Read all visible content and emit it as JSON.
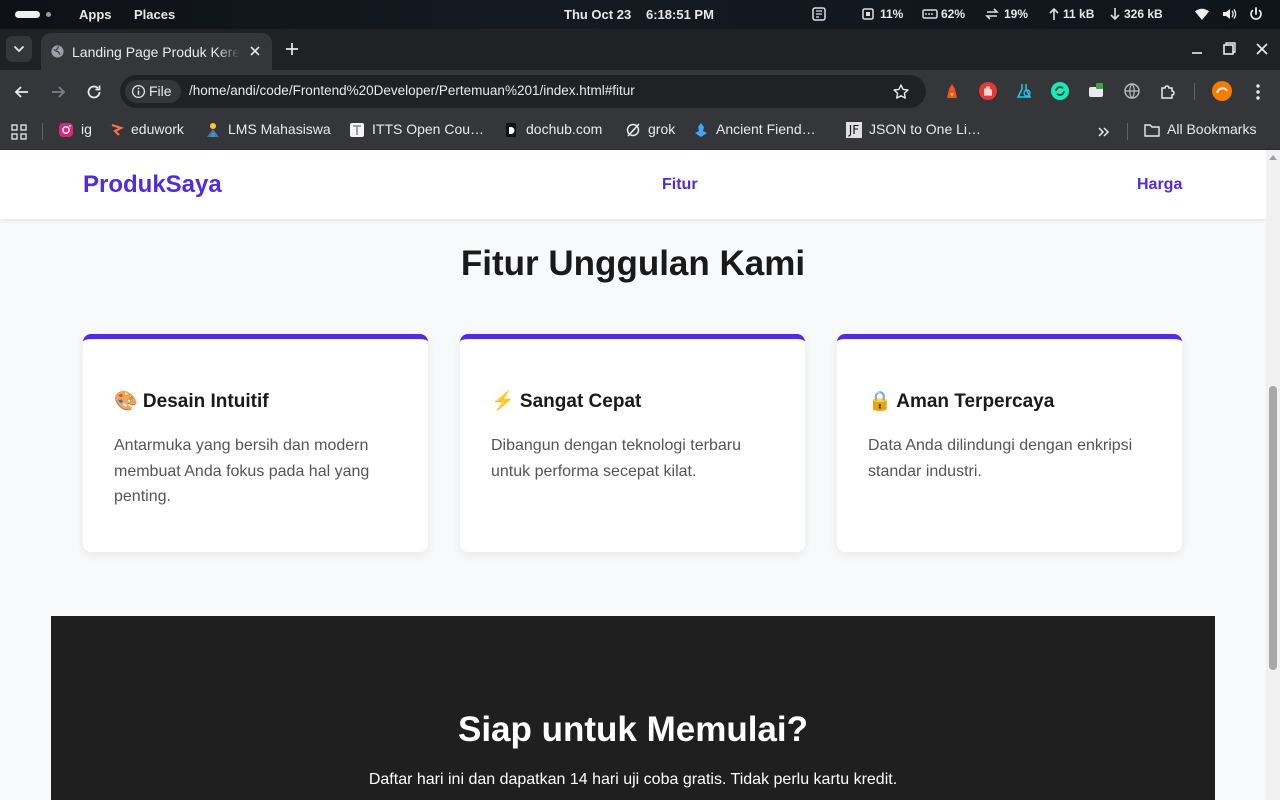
{
  "system_bar": {
    "apps_label": "Apps",
    "places_label": "Places",
    "date": "Thu Oct 23",
    "time": "6:18:51 PM",
    "cpu": "11%",
    "memory": "62%",
    "swap": "19%",
    "upload": "11 kB",
    "download": "326 kB"
  },
  "browser": {
    "tab_title": "Landing Page Produk Keren",
    "site_info_label": "File",
    "url": "/home/andi/code/Frontend%20Developer/Pertemuan%201/index.html#fitur",
    "bookmarks": [
      {
        "label": "ig",
        "icon": "instagram-icon"
      },
      {
        "label": "eduwork",
        "icon": "eduwork-icon"
      },
      {
        "label": "LMS Mahasiswa",
        "icon": "lms-icon"
      },
      {
        "label": "ITTS Open Cou…",
        "icon": "itts-icon"
      },
      {
        "label": "dochub.com",
        "icon": "dochub-icon"
      },
      {
        "label": "grok",
        "icon": "grok-icon"
      },
      {
        "label": "Ancient Fiend…",
        "icon": "ancient-fiend-icon"
      },
      {
        "label": "JSON to One Li…",
        "icon": "json-icon"
      }
    ],
    "json_favicon_text": "JF",
    "all_bookmarks_label": "All Bookmarks"
  },
  "page": {
    "brand": "ProdukSaya",
    "nav": {
      "fitur": "Fitur",
      "harga": "Harga"
    },
    "features_title": "Fitur Unggulan Kami",
    "cards": [
      {
        "title": "🎨 Desain Intuitif",
        "desc": "Antarmuka yang bersih dan modern membuat Anda fokus pada hal yang penting."
      },
      {
        "title": "⚡ Sangat Cepat",
        "desc": "Dibangun dengan teknologi terbaru untuk performa secepat kilat."
      },
      {
        "title": "🔒 Aman Terpercaya",
        "desc": "Data Anda dilindungi dengan enkripsi standar industri."
      }
    ],
    "cta": {
      "title": "Siap untuk Memulai?",
      "text": "Daftar hari ini dan dapatkan 14 hari uji coba gratis. Tidak perlu kartu kredit."
    }
  },
  "colors": {
    "accent": "#4f2be3",
    "cta_bg": "#1f1f1f",
    "chrome_dark": "#202124",
    "chrome_toolbar": "#35363a"
  }
}
